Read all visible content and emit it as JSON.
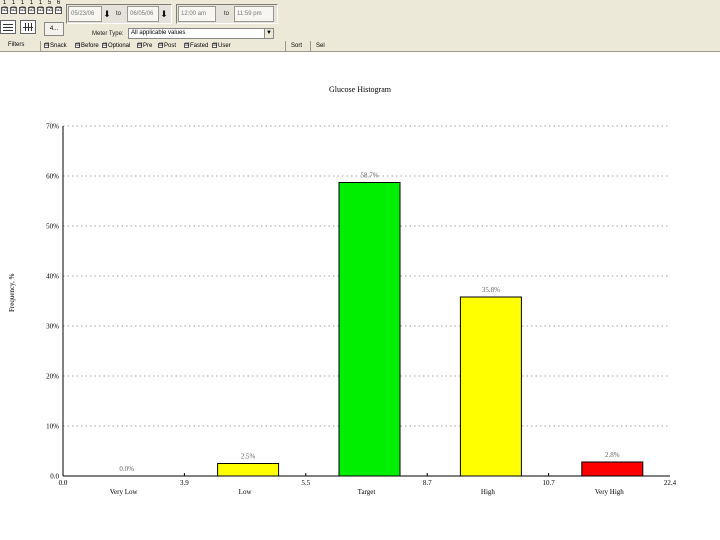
{
  "toolbar": {
    "days": [
      "1",
      "1",
      "1",
      "1",
      "1",
      "5",
      "6"
    ],
    "day_checks": [
      "☑",
      "☑",
      "☑",
      "☑",
      "☑",
      "☑",
      "☑"
    ],
    "small_button": "4...",
    "date_from": "05/23/06",
    "to_label": "to",
    "date_to": "06/05/06",
    "time_from": "12:00 am",
    "time_sep": "to",
    "time_to": "11:59 pm",
    "meter_type_label": "Meter Type:",
    "meter_type_value": "All applicable values",
    "filters_label": "Filters",
    "filters": [
      "Snack",
      "Before",
      "Optional",
      "Pre",
      "Post",
      "Fasted",
      "User"
    ],
    "extra_buttons": [
      "Sort",
      "Sel"
    ]
  },
  "chart_data": {
    "type": "bar",
    "title": "Glucose Histogram",
    "ylabel": "Frequency, %",
    "ylim": [
      0,
      70
    ],
    "yticks": [
      "0.0",
      "10%",
      "20%",
      "30%",
      "40%",
      "50%",
      "60%",
      "70%"
    ],
    "categories": [
      "Very Low",
      "Low",
      "Target",
      "High",
      "Very High"
    ],
    "values": [
      0.0,
      2.5,
      58.7,
      35.8,
      2.8
    ],
    "value_labels": [
      "0.0%",
      "2.5%",
      "58.7%",
      "35.8%",
      "2.8%"
    ],
    "boundaries": [
      "0.0",
      "3.9",
      "5.5",
      "8.7",
      "10.7",
      "22.4"
    ],
    "colors": [
      "#ffff00",
      "#ffff00",
      "#00ee00",
      "#ffff00",
      "#ff0000"
    ],
    "grid": true
  }
}
